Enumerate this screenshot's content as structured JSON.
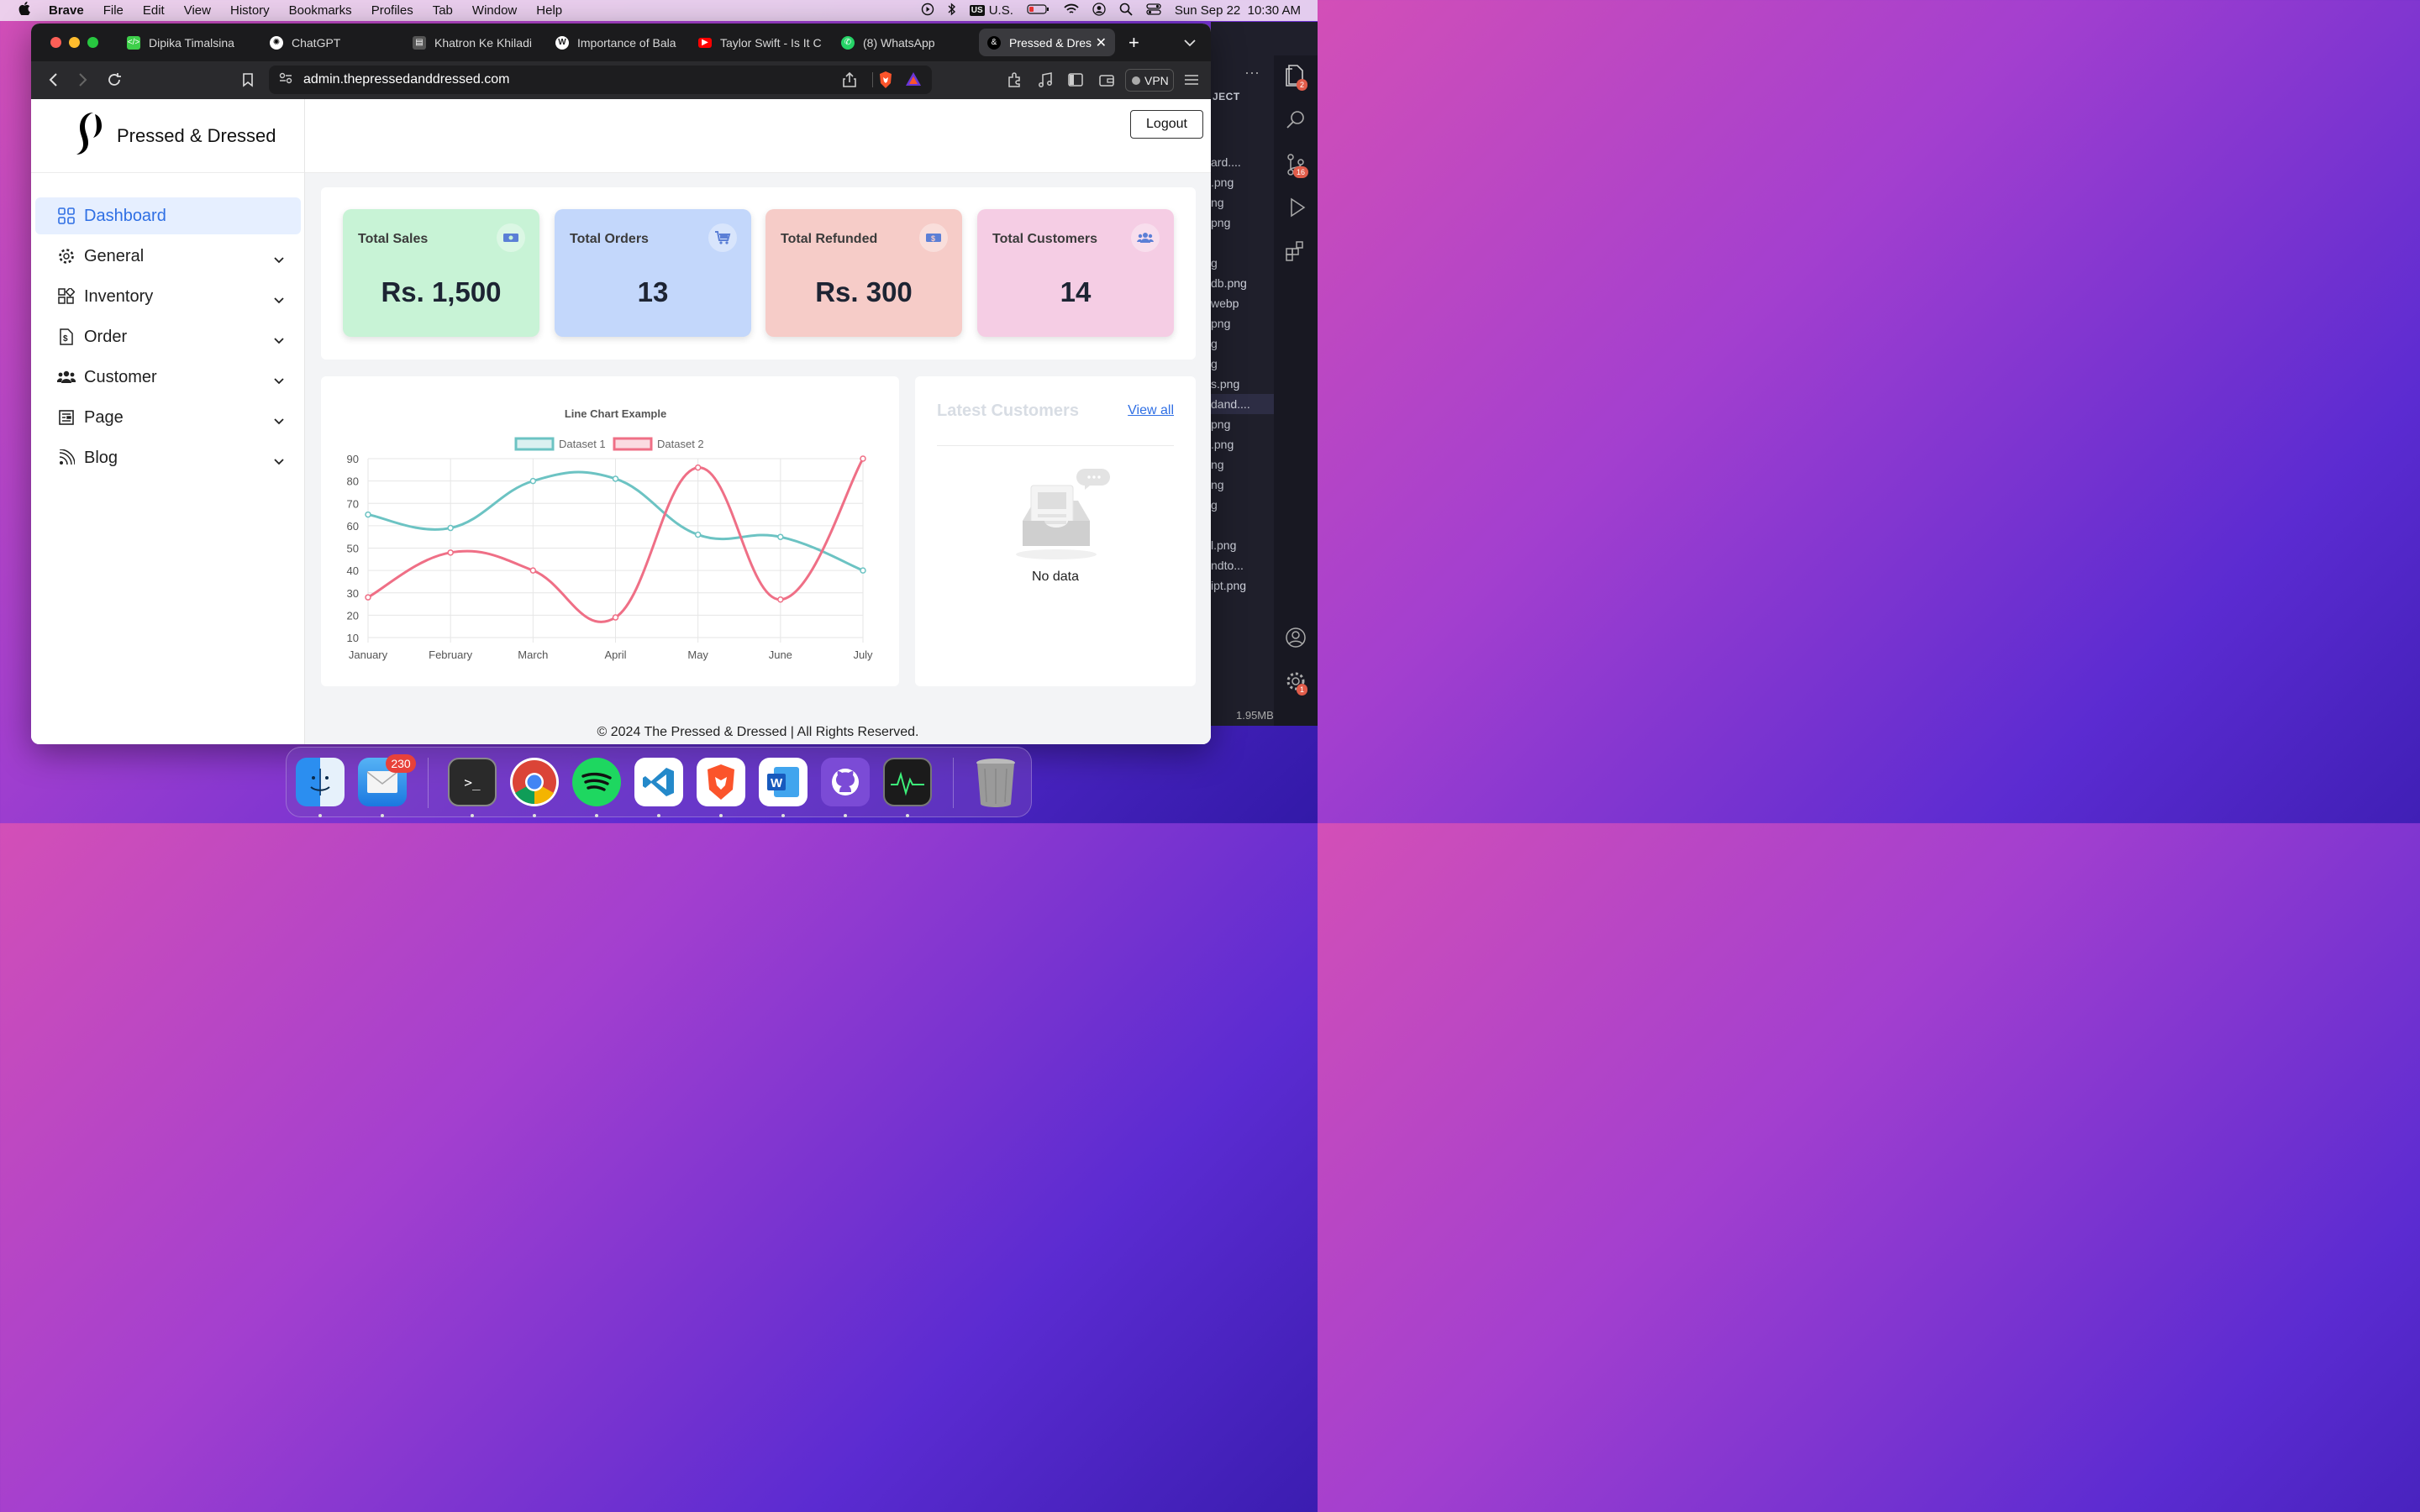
{
  "menubar": {
    "app": "Brave",
    "items": [
      "File",
      "Edit",
      "View",
      "History",
      "Bookmarks",
      "Profiles",
      "Tab",
      "Window",
      "Help"
    ],
    "input_source": "U.S.",
    "datetime": "Sun Sep 22  10:30 AM"
  },
  "browser": {
    "tabs": [
      {
        "title": "Dipika Timalsina",
        "icon": "green-code-icon",
        "color": "#3ecf4a"
      },
      {
        "title": "ChatGPT",
        "icon": "chatgpt-icon",
        "color": "#ffffff"
      },
      {
        "title": "Khatron Ke Khiladi",
        "icon": "film-icon",
        "color": "#888888"
      },
      {
        "title": "Importance of Bala",
        "icon": "wordpress-icon",
        "color": "#ffffff"
      },
      {
        "title": "Taylor Swift - Is It C",
        "icon": "youtube-icon",
        "color": "#ff0000"
      },
      {
        "title": "(8) WhatsApp",
        "icon": "whatsapp-icon",
        "color": "#25d366"
      },
      {
        "title": "Pressed & Dres",
        "icon": "site-logo-icon",
        "color": "#000000",
        "active": true
      }
    ],
    "url": "admin.thepressedanddressed.com",
    "vpn_label": "VPN"
  },
  "site": {
    "brand": "Pressed & Dressed",
    "logout": "Logout",
    "nav": [
      {
        "label": "Dashboard",
        "icon": "grid-icon",
        "active": true
      },
      {
        "label": "General",
        "icon": "gear-icon"
      },
      {
        "label": "Inventory",
        "icon": "apps-icon"
      },
      {
        "label": "Order",
        "icon": "document-dollar-icon"
      },
      {
        "label": "Customer",
        "icon": "users-icon"
      },
      {
        "label": "Page",
        "icon": "page-icon"
      },
      {
        "label": "Blog",
        "icon": "rss-icon"
      }
    ],
    "stats": [
      {
        "label": "Total Sales",
        "value": "Rs. 1,500",
        "bg": "#c8f3d6",
        "icon": "money-icon"
      },
      {
        "label": "Total Orders",
        "value": "13",
        "bg": "#c3d7fb",
        "icon": "cart-icon"
      },
      {
        "label": "Total Refunded",
        "value": "Rs. 300",
        "bg": "#f6ccc8",
        "icon": "refund-icon"
      },
      {
        "label": "Total Customers",
        "value": "14",
        "bg": "#f5cde4",
        "icon": "users-icon"
      }
    ],
    "latest_customers": {
      "title": "Latest Customers",
      "view_all": "View all",
      "empty": "No data"
    },
    "footer": "© 2024 The Pressed & Dressed | All Rights Reserved."
  },
  "chart_data": {
    "type": "line",
    "title": "Line Chart Example",
    "categories": [
      "January",
      "February",
      "March",
      "April",
      "May",
      "June",
      "July"
    ],
    "series": [
      {
        "name": "Dataset 1",
        "values": [
          65,
          59,
          80,
          81,
          56,
          55,
          40
        ],
        "color": "#6cc3c3"
      },
      {
        "name": "Dataset 2",
        "values": [
          28,
          48,
          40,
          19,
          86,
          27,
          90
        ],
        "color": "#ef6f86"
      }
    ],
    "ylim": [
      10,
      90
    ],
    "yticks": [
      10,
      20,
      30,
      40,
      50,
      60,
      70,
      80,
      90
    ],
    "grid": true,
    "legend": "top"
  },
  "vscode": {
    "section": "JECT",
    "files": [
      "",
      "",
      "ard....",
      ".png",
      "ng",
      "png",
      "",
      "g",
      "db.png",
      "webp",
      "png",
      "g",
      "g",
      "s.png",
      "dand....",
      "png",
      ".png",
      "ng",
      "ng",
      "g",
      "",
      "l.png",
      "ndto...",
      "ipt.png"
    ],
    "status_size": "1.95MB",
    "badges": [
      "2",
      "16",
      "1"
    ]
  },
  "dock": {
    "apps": [
      "finder-icon",
      "mail-icon",
      "terminal-icon",
      "chrome-icon",
      "spotify-icon",
      "vscode-icon",
      "brave-icon",
      "word-icon",
      "github-icon",
      "activity-monitor-icon",
      "trash-icon"
    ],
    "mail_badge": "230"
  }
}
